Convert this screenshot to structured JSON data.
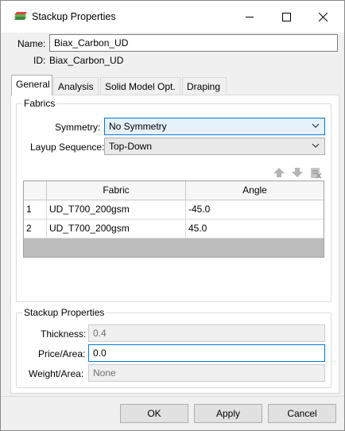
{
  "window": {
    "title": "Stackup Properties",
    "icon": "stackup-app-icon",
    "controls": {
      "minimize": "minimize-icon",
      "maximize": "maximize-icon",
      "close": "close-icon"
    }
  },
  "header": {
    "name_label": "Name:",
    "name_value": "Biax_Carbon_UD",
    "id_label": "ID:",
    "id_value": "Biax_Carbon_UD"
  },
  "tabs": [
    {
      "label": "General",
      "active": true
    },
    {
      "label": "Analysis",
      "active": false
    },
    {
      "label": "Solid Model Opt.",
      "active": false
    },
    {
      "label": "Draping",
      "active": false
    }
  ],
  "fabrics": {
    "group_title": "Fabrics",
    "symmetry_label": "Symmetry:",
    "symmetry_value": "No Symmetry",
    "layup_label": "Layup Sequence:",
    "layup_value": "Top-Down",
    "toolbar_icons": [
      "move-up-icon",
      "move-down-icon",
      "delete-row-icon"
    ],
    "table": {
      "columns": [
        "",
        "Fabric",
        "Angle"
      ],
      "rows": [
        {
          "index": "1",
          "fabric": "UD_T700_200gsm",
          "angle": "-45.0"
        },
        {
          "index": "2",
          "fabric": "UD_T700_200gsm",
          "angle": "45.0"
        }
      ]
    }
  },
  "stackup": {
    "group_title": "Stackup Properties",
    "thickness_label": "Thickness:",
    "thickness_value": "0.4",
    "price_label": "Price/Area:",
    "price_value": "0.0",
    "weight_label": "Weight/Area:",
    "weight_value": "None"
  },
  "buttons": {
    "ok": "OK",
    "apply": "Apply",
    "cancel": "Cancel"
  },
  "colors": {
    "focus_blue": "#0078d7",
    "combo_focus_bg": "#e5f1fb",
    "table_empty": "#bdbdbd"
  }
}
